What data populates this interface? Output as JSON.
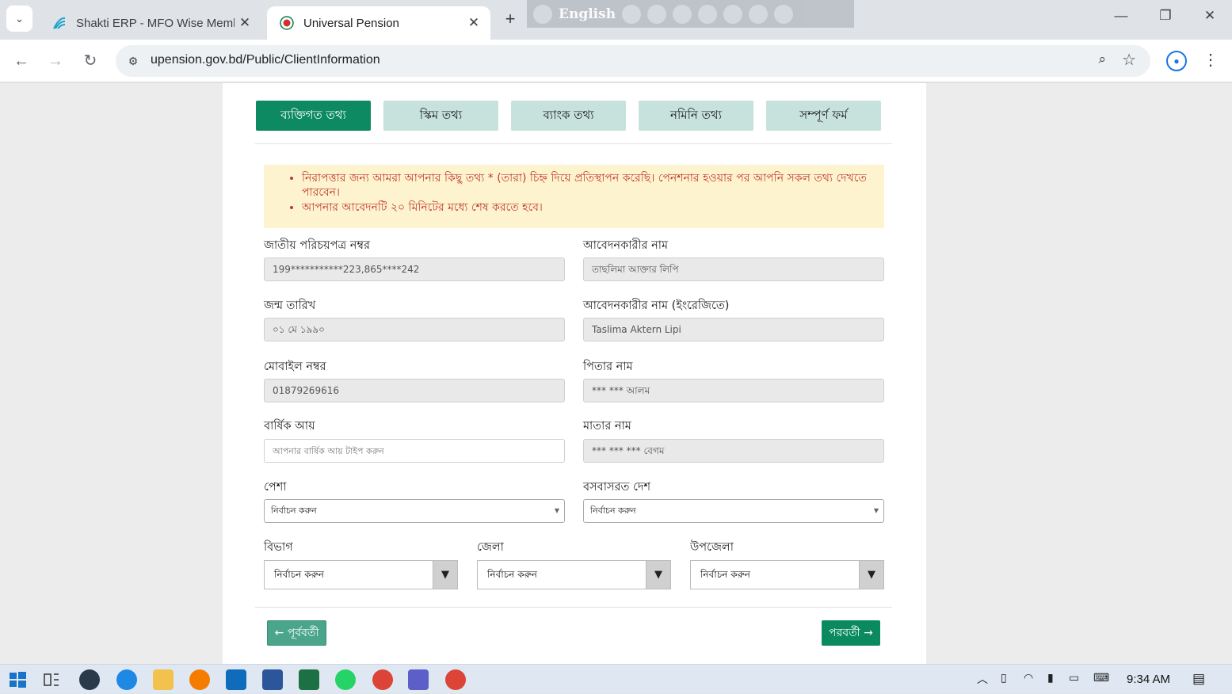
{
  "browser": {
    "tabs": [
      {
        "title": "Shakti ERP - MFO Wise Membe",
        "active": false
      },
      {
        "title": "Universal Pension",
        "active": true
      }
    ],
    "language": "English",
    "url": "upension.gov.bd/Public/ClientInformation"
  },
  "steps": [
    "ব্যক্তিগত তথ্য",
    "স্কিম তথ্য",
    "ব্যাংক তথ্য",
    "নমিনি তথ্য",
    "সম্পূর্ণ ফর্ম"
  ],
  "notice": [
    "নিরাপত্তার জন্য আমরা আপনার কিছু তথ্য * (তারা) চিহ্ন দিয়ে প্রতিস্থাপন করেছি। পেনশনার হওয়ার পর আপনি সকল তথ্য দেখতে পারবেন।",
    "আপনার আবেদনটি ২০ মিনিটের মধ্যে শেষ করতে হবে।"
  ],
  "form": {
    "nid_label": "জাতীয় পরিচয়পত্র নম্বর",
    "nid_value": "199***********223,865****242",
    "name_label": "আবেদনকারীর নাম",
    "name_value": "তাছলিমা আক্তার লিপি",
    "dob_label": "জন্ম তারিখ",
    "dob_value": "০১ মে ১৯৯০",
    "name_en_label": "আবেদনকারীর নাম (ইংরেজিতে)",
    "name_en_value": "Taslima Aktern  Lipi",
    "mobile_label": "মোবাইল নম্বর",
    "mobile_value": "01879269616",
    "father_label": "পিতার নাম",
    "father_value": "*** *** আলম",
    "income_label": "বার্ষিক আয়",
    "income_placeholder": "আপনার বার্ষিক আয় টাইপ করুন",
    "mother_label": "মাতার নাম",
    "mother_value": "*** *** *** বেগম",
    "occupation_label": "পেশা",
    "occupation_value": "নির্বাচন করুন",
    "country_label": "বসবাসরত দেশ",
    "country_value": "নির্বাচন করুন",
    "division_label": "বিভাগ",
    "division_value": "নির্বাচন করুন",
    "district_label": "জেলা",
    "district_value": "নির্বাচন করুন",
    "upazila_label": "উপজেলা",
    "upazila_value": "নির্বাচন করুন"
  },
  "buttons": {
    "prev": "← পূর্ববর্তী",
    "next": "পরবর্তী →"
  },
  "taskbar": {
    "time": "9:34 AM"
  },
  "colors": {
    "primary": "#0d8a62",
    "step_inactive": "#c7e1dc",
    "notice_bg": "#fef3cf",
    "notice_text": "#c0392b"
  }
}
